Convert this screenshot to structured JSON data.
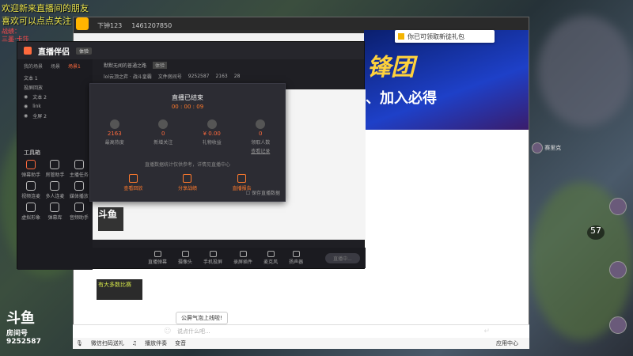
{
  "overlay": {
    "line1": "欢迎新来直播间的朋友",
    "line2": "喜欢可以点点关注",
    "line3": "战绩：",
    "line4": "三墨·卡莎"
  },
  "browser": {
    "user": "下钟123",
    "phone": "1461207850",
    "tip": "你已可领取新徒礼包",
    "banner_big": "锋团",
    "banner_sub": "、加入必得"
  },
  "app": {
    "logo": "直播伴侣",
    "version": "体验",
    "tabs": [
      "我的场景",
      "场景",
      "场景1"
    ],
    "scenes": [
      "文本 1",
      "投屏回放",
      "文本 2",
      "link",
      "全屏 2"
    ],
    "tools_title": "工具箱",
    "tools": [
      "弹幕助手",
      "房管助手",
      "主播任务",
      "视频连麦",
      "多人连麦",
      "媒体播放",
      "虚拟形象",
      "弹幕库",
      "音频助手",
      "",
      "",
      ""
    ],
    "room_name": "默默无闻的普通之路",
    "room_tag": "体验",
    "room_game": "lol云顶之弈 · 战斗皇霸",
    "room_id_label": "文件房间号",
    "room_id": "9252587",
    "viewers": "2163",
    "fans": "28",
    "bottom_tools": [
      "直播弹幕",
      "摄像头",
      "手机投屏",
      "录屏插件",
      "麦克风",
      "扬声器"
    ],
    "start_label": "直播中..."
  },
  "dialog": {
    "title": "直播已结束",
    "time": "00 : 00 : 09",
    "stats": [
      {
        "value": "2163",
        "label": "最高热度"
      },
      {
        "value": "0",
        "label": "新增关注"
      },
      {
        "value": "¥ 0.00",
        "label": "礼物收益"
      },
      {
        "value": "0",
        "label": "领取人数"
      }
    ],
    "extra_link": "查看记录",
    "hint": "直播数据统计仅供参考，详情见直播中心",
    "actions": [
      "查看回放",
      "分享战绩",
      "直播报告"
    ],
    "checkbox": "保存直播数据"
  },
  "chat": {
    "placeholder": "说点什么吧...",
    "bubble": "公屏气泡上线啦!",
    "status_left": "微信扫码送礼",
    "status_mid": "播放伴奏",
    "status_right": "变音",
    "reply_label": "应用中心"
  },
  "stream_overlay": {
    "yellow_text": "有大多数比赛",
    "thumb_text": "斗鱼"
  },
  "douyu": {
    "brand": "斗鱼",
    "room_label": "房间号",
    "room_number": "9252587"
  },
  "hud": {
    "player": "赛里克",
    "score": "57"
  }
}
